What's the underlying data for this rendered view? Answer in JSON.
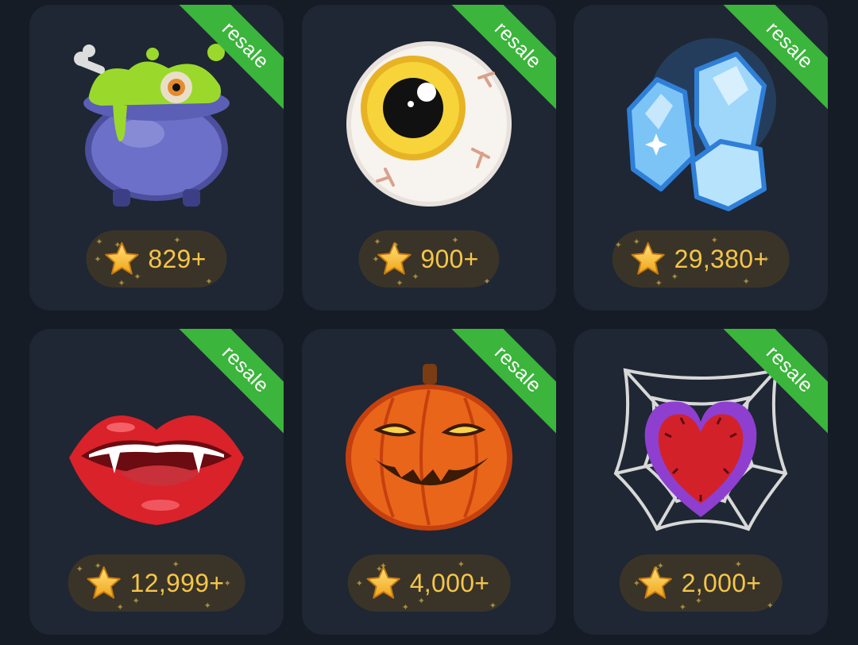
{
  "ribbon_label": "resale",
  "colors": {
    "background": "#151c25",
    "card": "#1e2733",
    "ribbon": "#3bb53b",
    "price_pill": "#3a3428",
    "price_text": "#f5c54a"
  },
  "gifts": [
    {
      "name": "cauldron",
      "icon": "cauldron-icon",
      "price": "829+"
    },
    {
      "name": "eyeball",
      "icon": "eyeball-icon",
      "price": "900+"
    },
    {
      "name": "crystals",
      "icon": "crystals-icon",
      "price": "29,380+"
    },
    {
      "name": "vampire-lips",
      "icon": "vampire-lips-icon",
      "price": "12,999+"
    },
    {
      "name": "pumpkin",
      "icon": "pumpkin-icon",
      "price": "4,000+"
    },
    {
      "name": "spiderweb-heart",
      "icon": "spiderweb-heart-icon",
      "price": "2,000+"
    }
  ]
}
